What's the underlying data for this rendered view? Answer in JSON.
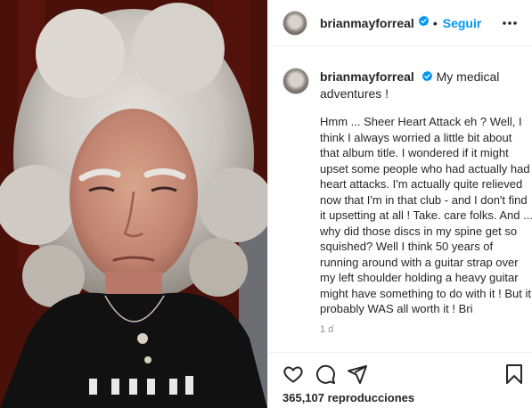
{
  "post": {
    "username": "brianmayforreal",
    "follow_label": "Seguir",
    "separator": "•",
    "caption_title": "My medical adventures !",
    "caption_body": "Hmm ... Sheer Heart Attack eh ? Well, I think I always worried a little bit about that album title. I wondered if it might upset some people who had actually had heart attacks. I'm actually quite relieved now that I'm in that club - and I don't find it upsetting at all ! Take. care folks. And ... why did those discs in my spine get so squished? Well I think 50 years of running around with a guitar strap over my left shoulder holding a heavy guitar might have something to do with it ! But it probably WAS all worth it ! Bri",
    "timestamp": "1 d",
    "views": "365,107 reproducciones"
  },
  "icons": {
    "verified": "verified-badge-icon",
    "more": "more-options-icon",
    "like": "heart-icon",
    "comment": "comment-icon",
    "share": "share-icon",
    "save": "bookmark-icon"
  },
  "colors": {
    "accent": "#0095f6",
    "text": "#262626",
    "muted": "#8e8e8e",
    "border": "#efefef"
  }
}
